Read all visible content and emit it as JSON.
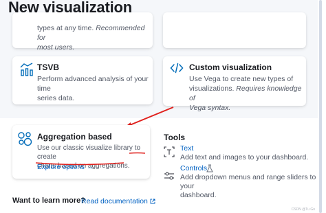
{
  "page": {
    "title": "New visualization"
  },
  "cards": {
    "top_left": {
      "desc_line1": "types at any time.",
      "desc_italic1": "Recommended for",
      "desc_italic2": "most users."
    },
    "tsvb": {
      "title": "TSVB",
      "desc_line1": "Perform advanced analysis of your time",
      "desc_line2": "series data."
    },
    "custom": {
      "title": "Custom visualization",
      "desc_line1": "Use Vega to create new types of",
      "desc_line2a": "visualizations.",
      "desc_line2b": "Requires knowledge of",
      "desc_line3": "Vega syntax."
    },
    "aggregation": {
      "title": "Aggregation based",
      "desc_line1": "Use our classic visualize library to create",
      "desc_line2": "charts based on aggregations.",
      "explore": "Explore options",
      "explore_arrow": "→"
    }
  },
  "tools": {
    "title": "Tools",
    "text": {
      "name": "Text",
      "desc": "Add text and images to your dashboard."
    },
    "controls": {
      "name": "Controls",
      "desc_line1": "Add dropdown menus and range sliders to your",
      "desc_line2": "dashboard."
    }
  },
  "footer": {
    "learn_label": "Want to learn more?",
    "doc_link": "Read documentation"
  },
  "watermark": "CSDN @Tu Go",
  "colors": {
    "link": "#0061c2",
    "annotation": "#e0201c",
    "icon": "#006bb8"
  }
}
